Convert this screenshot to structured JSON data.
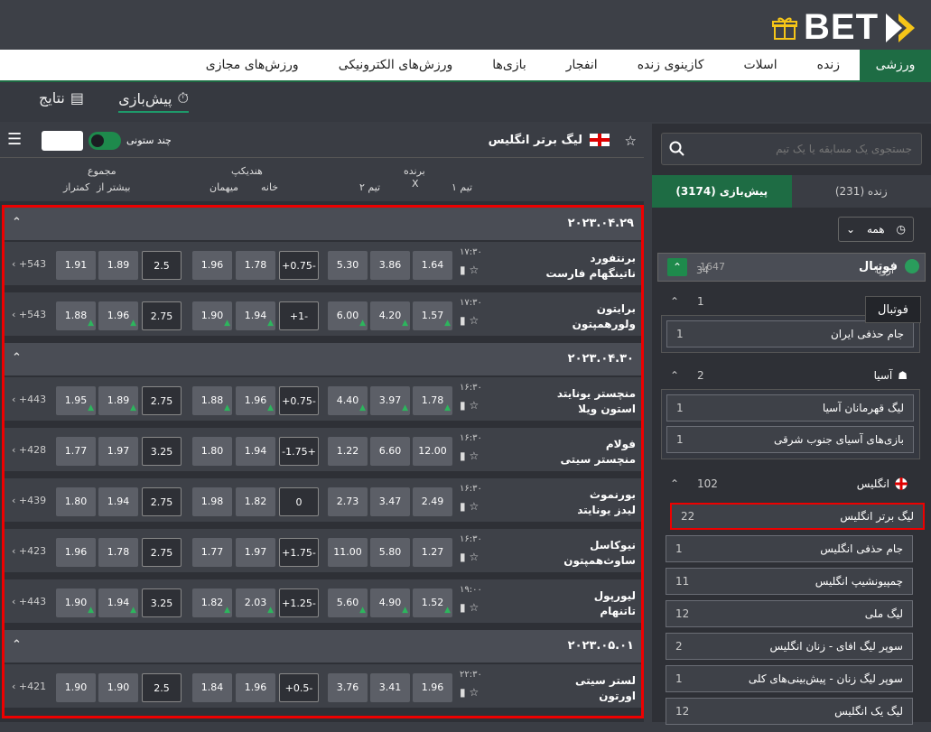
{
  "brand": {
    "logo_text": "BET"
  },
  "nav": [
    "ورزشی",
    "زنده",
    "اسلات",
    "کازینوی زنده",
    "انفجار",
    "بازی‌ها",
    "ورزش‌های الکترونیکی",
    "ورزش‌های مجازی"
  ],
  "subtabs": {
    "prematch": "پیش‌بازی",
    "results": "نتایج"
  },
  "sidebar": {
    "search_placeholder": "جستجوی یک مسابقه یا یک تیم",
    "tab_live": "زنده (231)",
    "tab_prematch": "پیش‌بازی (3174)",
    "filter": "همه",
    "sport": {
      "name": "فوتبال",
      "count": "1647",
      "count2": "34",
      "overlay": "اروپا"
    },
    "tooltip": "فوتبال",
    "r1": {
      "count": "1"
    },
    "iran_cup": {
      "name": "جام حذفی ایران",
      "count": "1"
    },
    "asia": {
      "name": "آسیا",
      "count": "2"
    },
    "asia_l1": {
      "name": "لیگ قهرمانان آسیا",
      "count": "1"
    },
    "asia_l2": {
      "name": "بازی‌های آسیای جنوب شرقی",
      "count": "1"
    },
    "england": {
      "name": "انگلیس",
      "count": "102"
    },
    "eng_l": [
      {
        "name": "لیگ برتر انگلیس",
        "count": "22"
      },
      {
        "name": "جام حذفی انگلیس",
        "count": "1"
      },
      {
        "name": "چمپیونشیپ انگلیس",
        "count": "11"
      },
      {
        "name": "لیگ ملی",
        "count": "12"
      },
      {
        "name": "سوپر لیگ افای - زنان انگلیس",
        "count": "2"
      },
      {
        "name": "سوپر لیگ زنان - پیش‌بینی‌های کلی",
        "count": "1"
      },
      {
        "name": "لیگ یک انگلیس",
        "count": "12"
      }
    ]
  },
  "main": {
    "league_title": "لیگ برتر انگلیس",
    "columns_label": "چند ستونی",
    "h_winner": "برنده",
    "h_team1": "تیم ۱",
    "h_x": "X",
    "h_team2": "تیم ۲",
    "h_handicap": "هندیکپ",
    "h_home": "خانه",
    "h_away": "میهمان",
    "h_total": "مجموع",
    "h_over": "بیشتر از",
    "h_under": "کمتراز"
  },
  "dates": [
    "۲۰۲۳.۰۴.۲۹",
    "۲۰۲۳.۰۴.۳۰",
    "۲۰۲۳.۰۵.۰۱"
  ],
  "matches": [
    {
      "t1": "برنتفورد",
      "t2": "ناتینگهام فارست",
      "time": "۱۷:۳۰",
      "o": [
        "1.64",
        "3.86",
        "5.30",
        "+0.75-",
        "1.78",
        "1.96",
        "2.5",
        "1.89",
        "1.91"
      ],
      "more": "+543"
    },
    {
      "t1": "برایتون",
      "t2": "ولورهمپتون",
      "time": "۱۷:۳۰",
      "o": [
        "1.57",
        "4.20",
        "6.00",
        "+1-",
        "1.94",
        "1.90",
        "2.75",
        "1.96",
        "1.88"
      ],
      "more": "+543"
    },
    {
      "t1": "منچستر یونایتد",
      "t2": "استون ویلا",
      "time": "۱۶:۳۰",
      "o": [
        "1.78",
        "3.97",
        "4.40",
        "+0.75-",
        "1.96",
        "1.88",
        "2.75",
        "1.89",
        "1.95"
      ],
      "more": "+443"
    },
    {
      "t1": "فولام",
      "t2": "منچستر سیتی",
      "time": "۱۶:۳۰",
      "o": [
        "12.00",
        "6.60",
        "1.22",
        "-1.75+",
        "1.94",
        "1.80",
        "3.25",
        "1.97",
        "1.77"
      ],
      "more": "+428"
    },
    {
      "t1": "بورنموث",
      "t2": "لیدز یونایتد",
      "time": "۱۶:۳۰",
      "o": [
        "2.49",
        "3.47",
        "2.73",
        "0",
        "1.82",
        "1.98",
        "2.75",
        "1.94",
        "1.80"
      ],
      "more": "+439"
    },
    {
      "t1": "نیوکاسل",
      "t2": "ساوث‌همپتون",
      "time": "۱۶:۳۰",
      "o": [
        "1.27",
        "5.80",
        "11.00",
        "+1.75-",
        "1.97",
        "1.77",
        "2.75",
        "1.78",
        "1.96"
      ],
      "more": "+423"
    },
    {
      "t1": "لیورپول",
      "t2": "تاتنهام",
      "time": "۱۹:۰۰",
      "o": [
        "1.52",
        "4.90",
        "5.60",
        "+1.25-",
        "2.03",
        "1.82",
        "3.25",
        "1.94",
        "1.90"
      ],
      "more": "+443"
    },
    {
      "t1": "لستر سیتی",
      "t2": "اورتون",
      "time": "۲۲:۳۰",
      "o": [
        "1.96",
        "3.41",
        "3.76",
        "+0.5-",
        "1.96",
        "1.84",
        "2.5",
        "1.90",
        "1.90"
      ],
      "more": "+421"
    }
  ],
  "colors": {
    "accent": "#1e6c44",
    "up": "#2db55d",
    "highlight": "#ee0000"
  }
}
